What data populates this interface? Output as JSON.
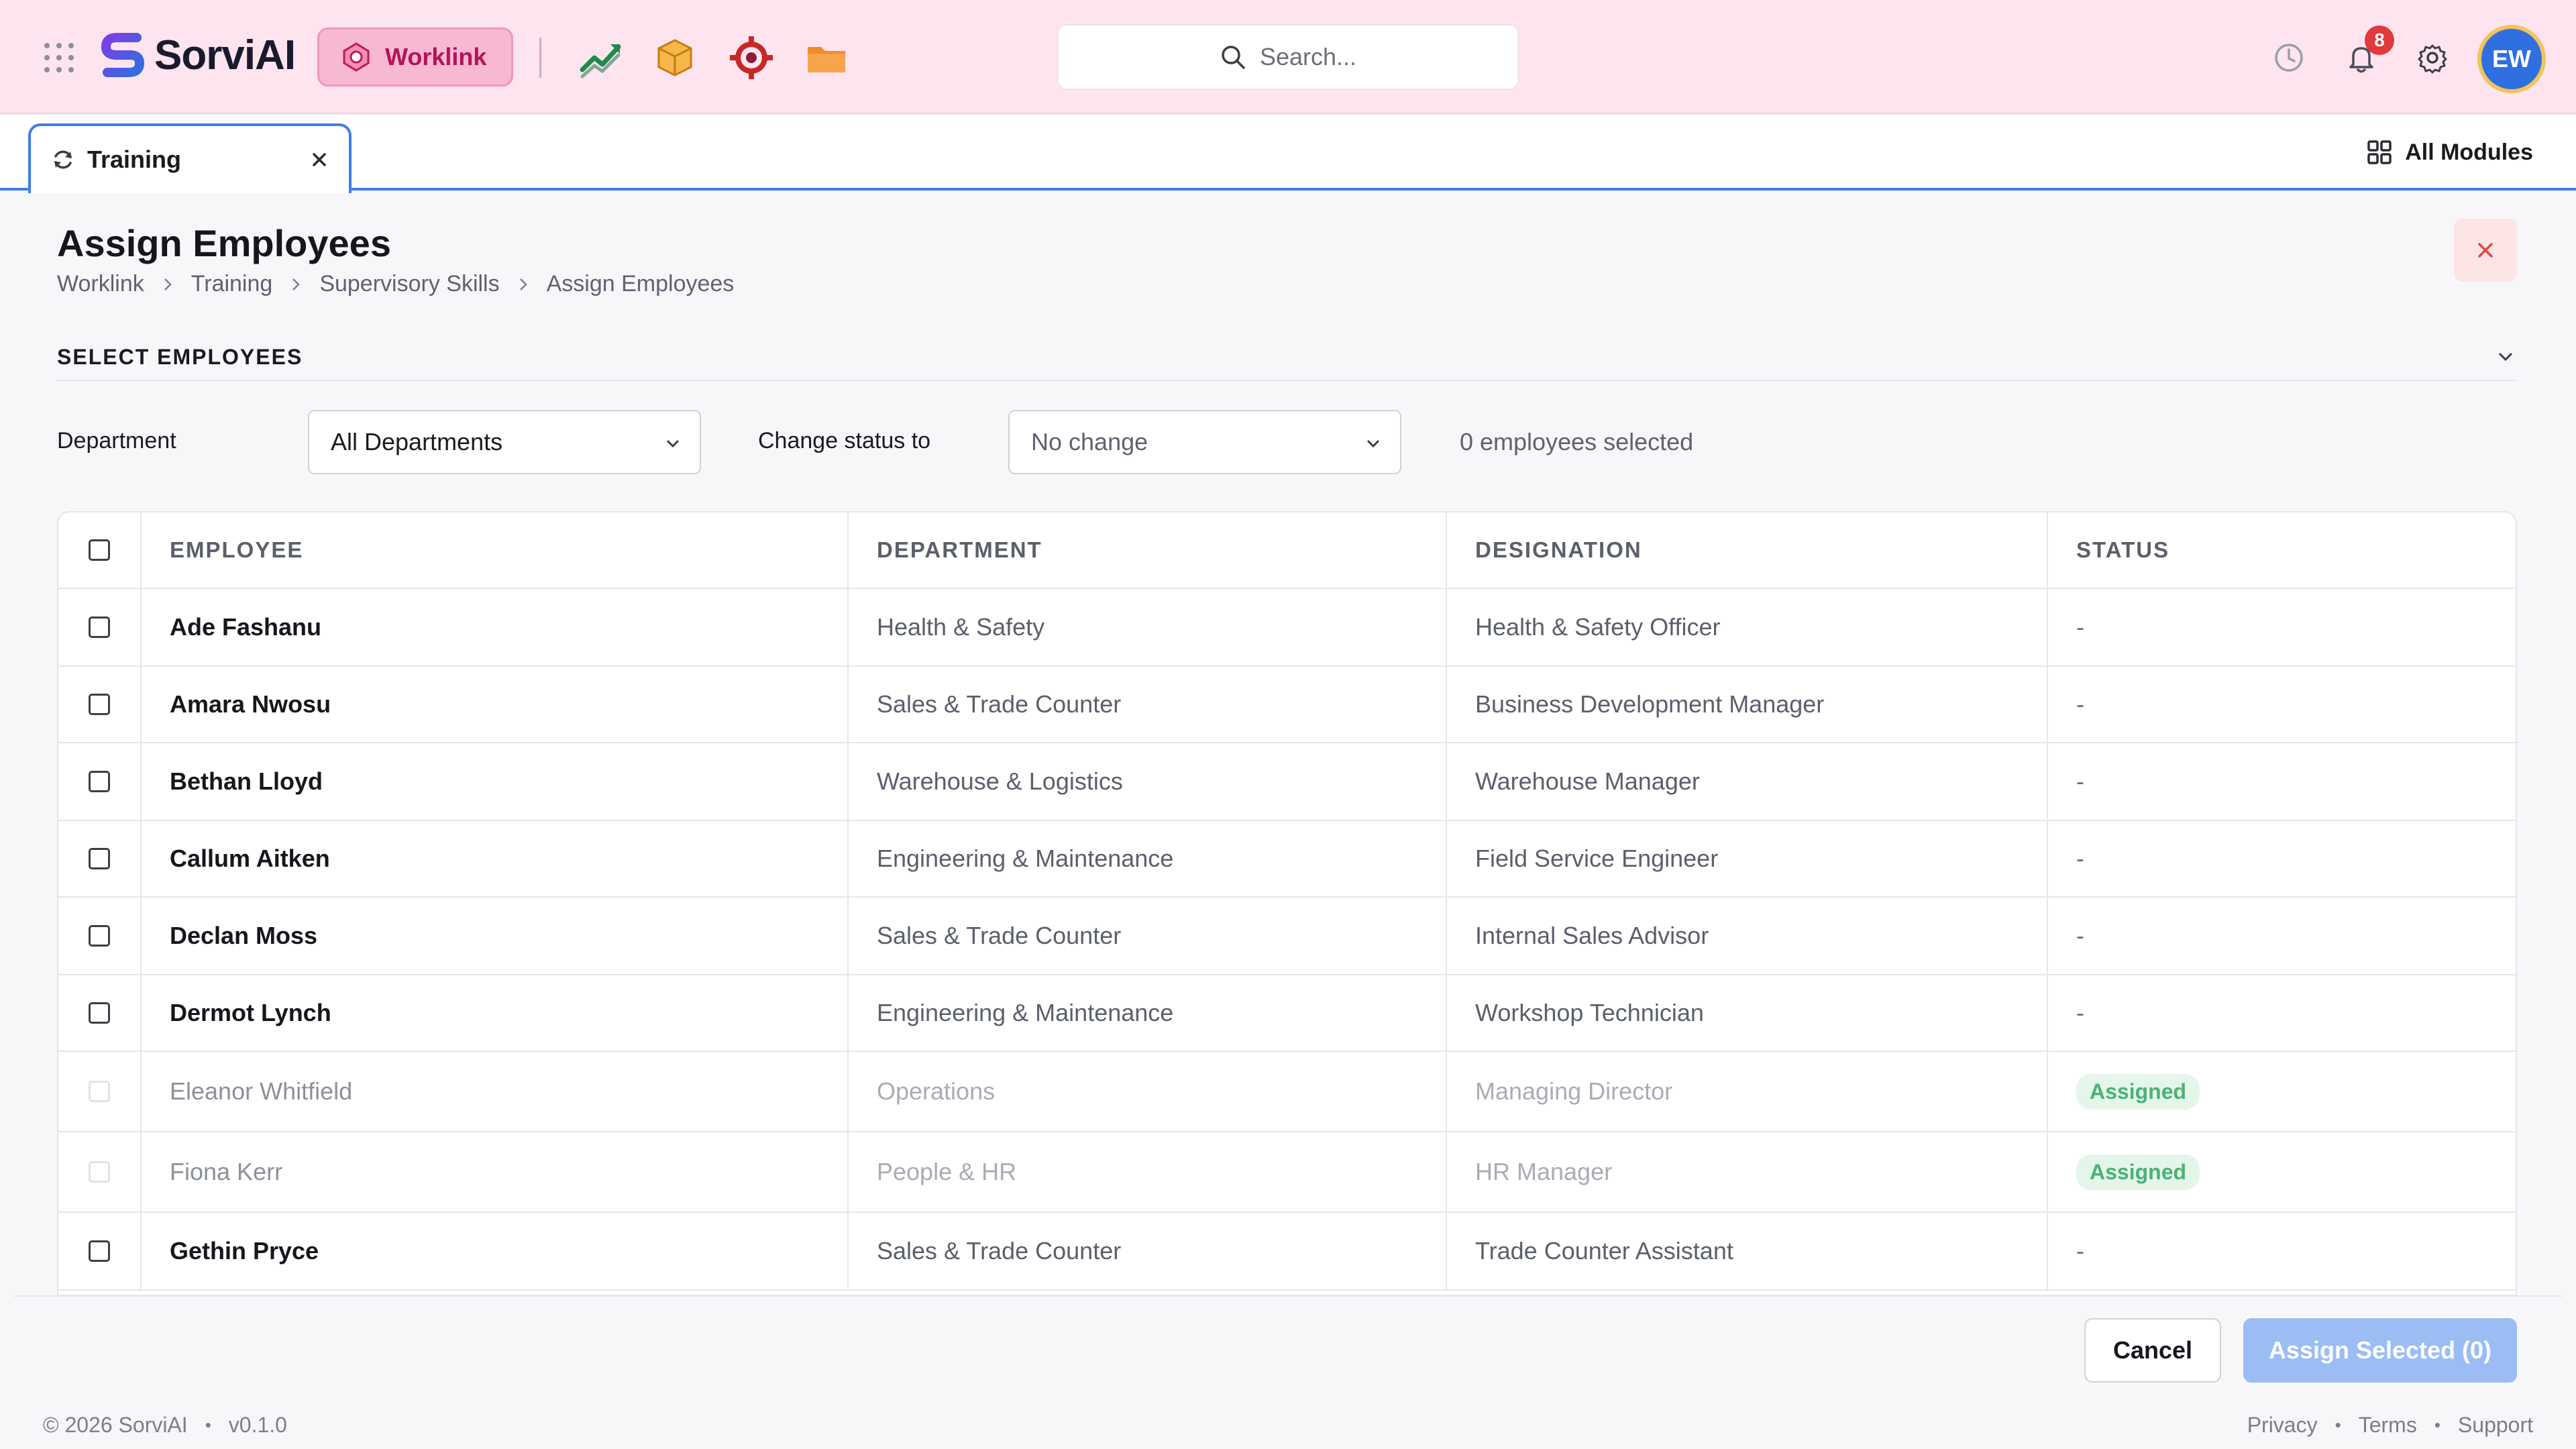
{
  "topbar": {
    "app_name": "SorviAI",
    "module_label": "Worklink",
    "search_placeholder": "Search...",
    "notification_count": "8",
    "avatar_initials": "EW",
    "accent": "#fde4ef",
    "icons": [
      "apps-grid-icon",
      "trend-chart-icon",
      "box-package-icon",
      "gear-target-icon",
      "folder-icon",
      "clock-icon",
      "bell-icon",
      "settings-icon"
    ]
  },
  "tabs": {
    "active_tab": "Training",
    "all_modules": "All Modules"
  },
  "page": {
    "title": "Assign Employees",
    "breadcrumb": [
      "Worklink",
      "Training",
      "Supervisory Skills",
      "Assign Employees"
    ],
    "section_title": "SELECT EMPLOYEES"
  },
  "filters": {
    "department_label": "Department",
    "department_value": "All Departments",
    "status_label": "Change status to",
    "status_value": "No change",
    "selected_count": "0 employees selected"
  },
  "table": {
    "headers": [
      "EMPLOYEE",
      "DEPARTMENT",
      "DESIGNATION",
      "STATUS"
    ],
    "rows": [
      {
        "name": "Ade Fashanu",
        "department": "Health & Safety",
        "designation": "Health & Safety Officer",
        "status": "-",
        "disabled": false
      },
      {
        "name": "Amara Nwosu",
        "department": "Sales & Trade Counter",
        "designation": "Business Development Manager",
        "status": "-",
        "disabled": false
      },
      {
        "name": "Bethan Lloyd",
        "department": "Warehouse & Logistics",
        "designation": "Warehouse Manager",
        "status": "-",
        "disabled": false
      },
      {
        "name": "Callum Aitken",
        "department": "Engineering & Maintenance",
        "designation": "Field Service Engineer",
        "status": "-",
        "disabled": false
      },
      {
        "name": "Declan Moss",
        "department": "Sales & Trade Counter",
        "designation": "Internal Sales Advisor",
        "status": "-",
        "disabled": false
      },
      {
        "name": "Dermot Lynch",
        "department": "Engineering & Maintenance",
        "designation": "Workshop Technician",
        "status": "-",
        "disabled": false
      },
      {
        "name": "Eleanor Whitfield",
        "department": "Operations",
        "designation": "Managing Director",
        "status": "Assigned",
        "disabled": true
      },
      {
        "name": "Fiona Kerr",
        "department": "People & HR",
        "designation": "HR Manager",
        "status": "Assigned",
        "disabled": true
      },
      {
        "name": "Gethin Pryce",
        "department": "Sales & Trade Counter",
        "designation": "Trade Counter Assistant",
        "status": "-",
        "disabled": false
      }
    ]
  },
  "actions": {
    "cancel": "Cancel",
    "assign": "Assign Selected (0)"
  },
  "footer": {
    "copyright": "© 2026 SorviAI",
    "version": "v0.1.0",
    "links": [
      "Privacy",
      "Terms",
      "Support"
    ]
  }
}
